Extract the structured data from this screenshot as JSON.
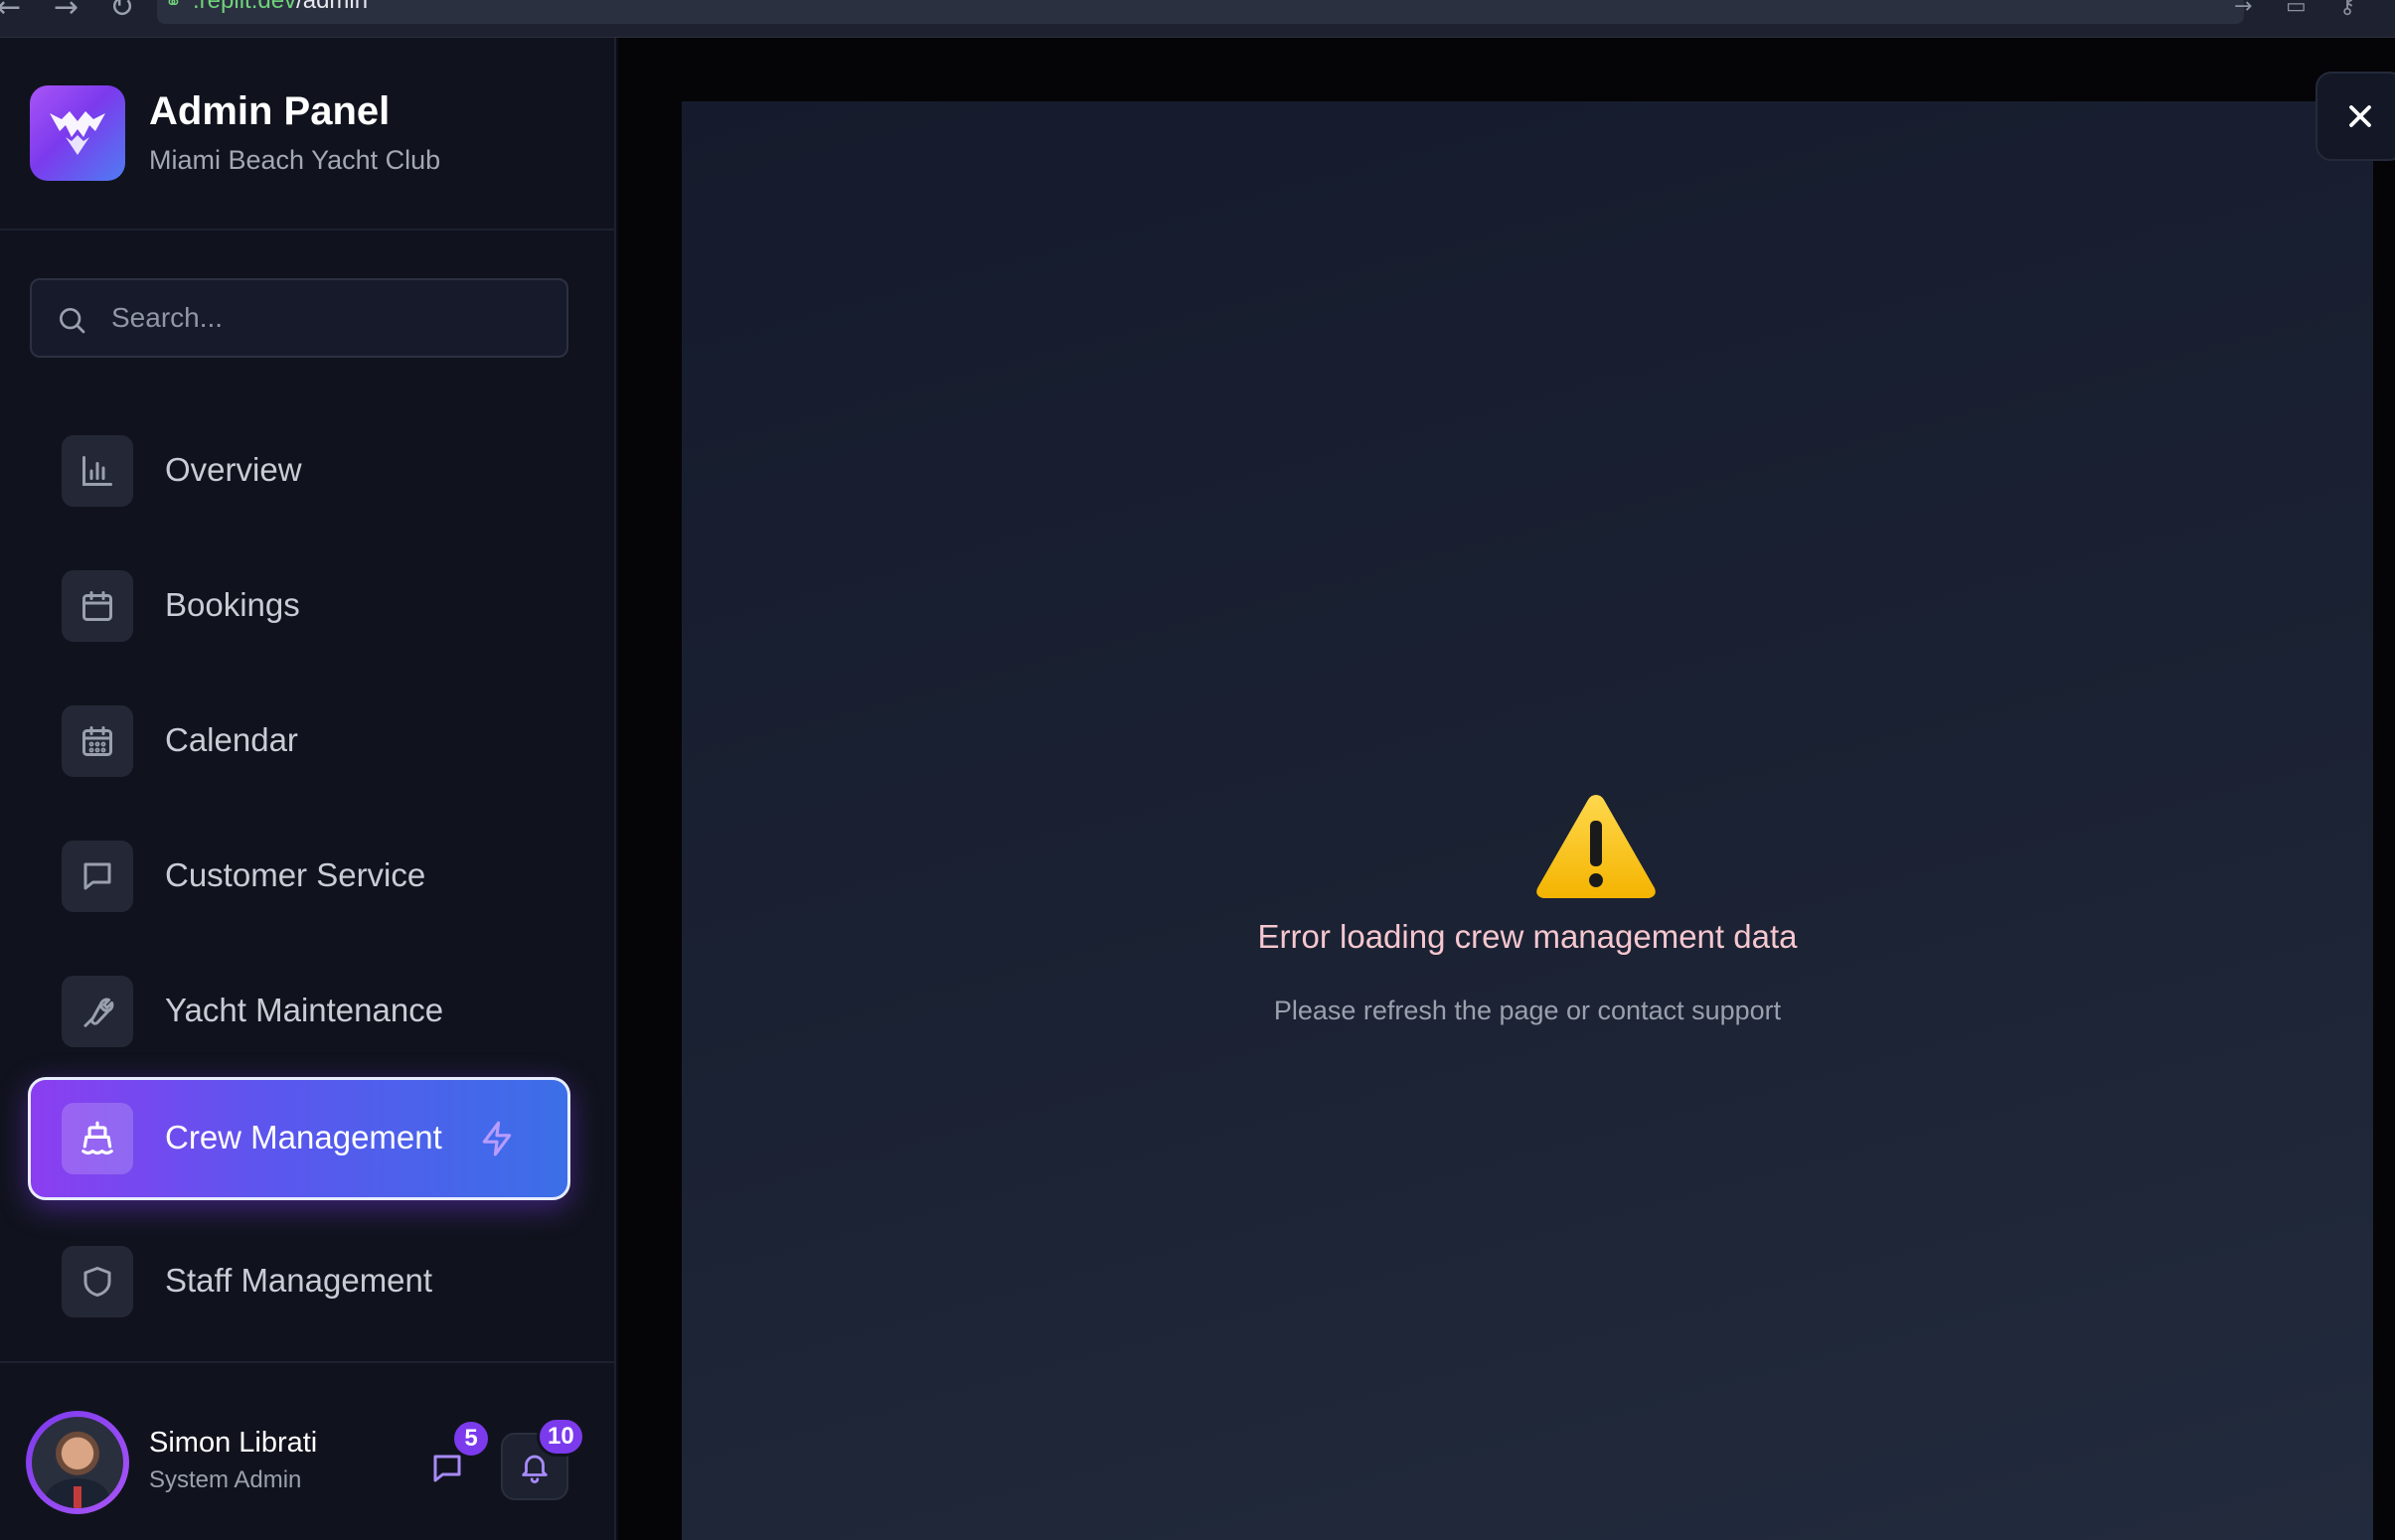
{
  "browser": {
    "url_host": ".replit.dev",
    "url_path": "/admin"
  },
  "brand": {
    "title": "Admin Panel",
    "subtitle": "Miami Beach Yacht Club",
    "logo_icon": "brand-logo-icon",
    "accent_color": "#7c3aed"
  },
  "search": {
    "placeholder": "Search...",
    "value": ""
  },
  "nav": {
    "items": [
      {
        "label": "Overview",
        "icon": "bar-chart-icon"
      },
      {
        "label": "Bookings",
        "icon": "calendar-icon"
      },
      {
        "label": "Calendar",
        "icon": "calendar-grid-icon"
      },
      {
        "label": "Customer Service",
        "icon": "message-square-icon"
      },
      {
        "label": "Yacht Maintenance",
        "icon": "wrench-icon"
      },
      {
        "label": "Crew Management",
        "icon": "ship-icon",
        "active": true
      },
      {
        "label": "Staff Management",
        "icon": "shield-icon"
      }
    ]
  },
  "user": {
    "name": "Simon Librati",
    "role": "System Admin",
    "messages_count": "5",
    "notifications_count": "10"
  },
  "main": {
    "error_title": "Error loading crew management data",
    "error_subtitle": "Please refresh the page or contact support",
    "warning_icon": "warning-icon"
  }
}
